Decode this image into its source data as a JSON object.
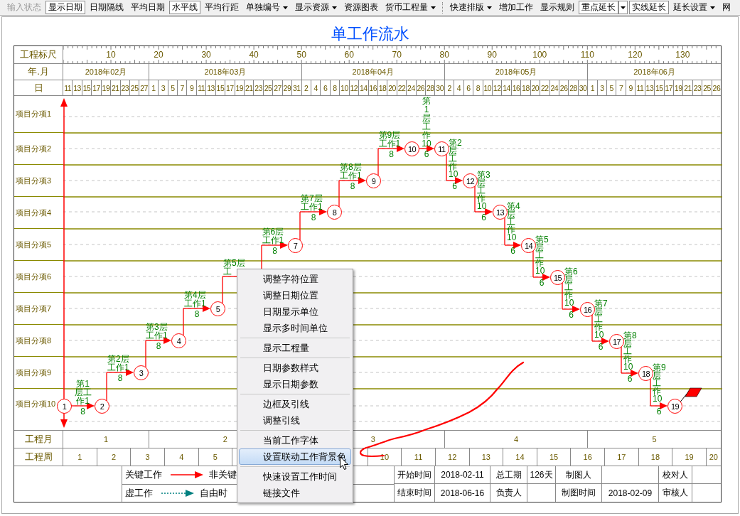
{
  "toolbar": [
    [
      {
        "label": "输入状态",
        "on": false,
        "disabled": true,
        "kind": "plain"
      },
      {
        "label": "显示日期",
        "on": true,
        "disabled": false,
        "kind": "plain"
      },
      {
        "label": "日期隔线",
        "on": false,
        "disabled": false,
        "kind": "plain"
      },
      {
        "label": "平均日期",
        "on": false,
        "disabled": false,
        "kind": "plain"
      },
      {
        "label": "水平线",
        "on": true,
        "disabled": false,
        "kind": "plain"
      },
      {
        "label": "平均行距",
        "on": false,
        "disabled": false,
        "kind": "plain"
      },
      {
        "label": "单独编号",
        "on": false,
        "disabled": false,
        "kind": "dropdown"
      },
      {
        "label": "显示资源",
        "on": false,
        "disabled": false,
        "kind": "dropdown"
      },
      {
        "label": "资源图表",
        "on": false,
        "disabled": false,
        "kind": "plain"
      },
      {
        "label": "货币工程量",
        "on": false,
        "disabled": false,
        "kind": "dropdown"
      }
    ],
    [
      {
        "label": "快速排版",
        "on": false,
        "disabled": false,
        "kind": "dropdown"
      },
      {
        "label": "增加工作",
        "on": false,
        "disabled": false,
        "kind": "plain"
      },
      {
        "label": "显示规则",
        "on": false,
        "disabled": false,
        "kind": "plain"
      },
      {
        "label": "重点延长",
        "on": true,
        "disabled": false,
        "kind": "split"
      },
      {
        "label": "实线延长",
        "on": true,
        "disabled": false,
        "kind": "plain"
      },
      {
        "label": "延长设置",
        "on": false,
        "disabled": false,
        "kind": "dropdown"
      },
      {
        "label": "网",
        "on": false,
        "disabled": false,
        "kind": "plain"
      }
    ]
  ],
  "title": "单工作流水",
  "headers": {
    "ruler": "工程标尺",
    "month": "年.月",
    "day": "日",
    "project_month": "工程月",
    "project_week": "工程周"
  },
  "ruler_ticks": [
    "10",
    "20",
    "30",
    "40",
    "50",
    "60",
    "70",
    "80",
    "90",
    "100",
    "110",
    "120",
    "130"
  ],
  "months": [
    {
      "label": "2018年02月",
      "days": [
        "11",
        "13",
        "15",
        "17",
        "19",
        "21",
        "23",
        "25",
        "27"
      ]
    },
    {
      "label": "2018年03月",
      "days": [
        "1",
        "3",
        "5",
        "7",
        "9",
        "11",
        "13",
        "15",
        "17",
        "19",
        "21",
        "23",
        "25",
        "27",
        "29",
        "31"
      ]
    },
    {
      "label": "2018年04月",
      "days": [
        "2",
        "4",
        "6",
        "8",
        "10",
        "12",
        "14",
        "16",
        "18",
        "20",
        "22",
        "24",
        "26",
        "28",
        "30"
      ]
    },
    {
      "label": "2018年05月",
      "days": [
        "2",
        "4",
        "6",
        "8",
        "10",
        "12",
        "14",
        "16",
        "18",
        "20",
        "22",
        "24",
        "26",
        "28",
        "30"
      ]
    },
    {
      "label": "2018年06月",
      "days": [
        "1",
        "3",
        "5",
        "7",
        "9",
        "11",
        "13",
        "15",
        "17",
        "19",
        "21",
        "23",
        "25",
        "26"
      ]
    }
  ],
  "rows": [
    "项目分项1",
    "项目分项2",
    "项目分项3",
    "项目分项4",
    "项目分项5",
    "项目分项6",
    "项目分项7",
    "项目分项8",
    "项目分项9",
    "项目分项10"
  ],
  "nodes": [
    "1",
    "2",
    "3",
    "4",
    "5",
    "7",
    "8",
    "9",
    "10",
    "11",
    "12",
    "13",
    "14",
    "15",
    "16",
    "17",
    "18",
    "19"
  ],
  "activities": [
    {
      "label": "第1层工作1",
      "duration": "8"
    },
    {
      "label": "第2层工作1",
      "duration": "8"
    },
    {
      "label": "第3层工作1",
      "duration": "8"
    },
    {
      "label": "第4层工作1",
      "duration": "8"
    },
    {
      "label": "第5层工"
    },
    {
      "label": "第6层工作1",
      "duration": "8"
    },
    {
      "label": "第7层工作1",
      "duration": "8"
    },
    {
      "label": "第8层工作1",
      "duration": "8"
    },
    {
      "label": "第9层工作1",
      "duration": "8"
    },
    {
      "label": "第1层工作10",
      "duration": "6"
    },
    {
      "label": "第2层工作10",
      "duration": "6"
    },
    {
      "label": "第3层工作10",
      "duration": "6"
    },
    {
      "label": "第4层工作10",
      "duration": "6"
    },
    {
      "label": "第5层工作10",
      "duration": "6"
    },
    {
      "label": "第6层工作10",
      "duration": "6"
    },
    {
      "label": "第7层工作10",
      "duration": "6"
    },
    {
      "label": "第8层工作10",
      "duration": "6"
    },
    {
      "label": "第9层工作10",
      "duration": "6"
    }
  ],
  "project_months": [
    "1",
    "2",
    "3",
    "4",
    "5"
  ],
  "project_weeks": [
    "1",
    "2",
    "3",
    "4",
    "5",
    "10",
    "11",
    "12",
    "13",
    "14",
    "15",
    "16",
    "17",
    "18",
    "19",
    "20"
  ],
  "legend": [
    {
      "label": "关键工作",
      "kind": "solid",
      "next": "非关键"
    },
    {
      "label": "虚工作",
      "kind": "dashed",
      "next": "自由时"
    }
  ],
  "info": [
    [
      {
        "label": "开始时间",
        "value": "2018-02-11"
      },
      {
        "label": "总工期",
        "value": "126天"
      },
      {
        "label": "制图人"
      },
      {
        "label": "校对人"
      }
    ],
    [
      {
        "label": "结束时间",
        "value": "2018-06-16"
      },
      {
        "label": "负责人"
      },
      {
        "label": "制图时间",
        "value": "2018-02-09"
      },
      {
        "label": "审核人"
      }
    ]
  ],
  "context_menu": [
    {
      "kind": "item",
      "label": "调整字符位置",
      "selected": false
    },
    {
      "kind": "item",
      "label": "调整日期位置",
      "selected": false
    },
    {
      "kind": "item",
      "label": "日期显示单位",
      "selected": false
    },
    {
      "kind": "item",
      "label": "显示多时间单位",
      "selected": false
    },
    {
      "kind": "separator"
    },
    {
      "kind": "item",
      "label": "显示工程量",
      "selected": false
    },
    {
      "kind": "separator"
    },
    {
      "kind": "item",
      "label": "日期参数样式",
      "selected": false
    },
    {
      "kind": "item",
      "label": "显示日期参数",
      "selected": false
    },
    {
      "kind": "separator"
    },
    {
      "kind": "item",
      "label": "边框及引线",
      "selected": false
    },
    {
      "kind": "item",
      "label": "调整引线",
      "selected": false
    },
    {
      "kind": "separator"
    },
    {
      "kind": "item",
      "label": "当前工作字体",
      "selected": false
    },
    {
      "kind": "item",
      "label": "设置联动工作背景色",
      "selected": true
    },
    {
      "kind": "separator"
    },
    {
      "kind": "item",
      "label": "快速设置工作时间",
      "selected": false
    },
    {
      "kind": "item",
      "label": "链接文件",
      "selected": false
    }
  ]
}
